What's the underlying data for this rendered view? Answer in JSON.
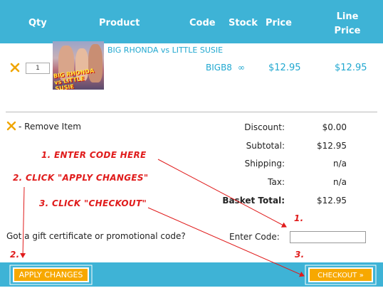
{
  "header": {
    "qty": "Qty",
    "product": "Product",
    "code": "Code",
    "stock": "Stock",
    "price": "Price",
    "line_price": "Line Price"
  },
  "item": {
    "quantity": "1",
    "product_name": "BIG RHONDA vs LITTLE SUSIE",
    "thumbnail_text": "BIG RHONDA vs LITTLE SUSIE",
    "code": "BIGB8",
    "stock": "∞",
    "price": "$12.95",
    "line_price": "$12.95"
  },
  "remove_label": "- Remove Item",
  "summary": {
    "discount_label": "Discount:",
    "discount_value": "$0.00",
    "subtotal_label": "Subtotal:",
    "subtotal_value": "$12.95",
    "shipping_label": "Shipping:",
    "shipping_value": "n/a",
    "tax_label": "Tax:",
    "tax_value": "n/a",
    "total_label": "Basket Total:",
    "total_value": "$12.95"
  },
  "promo": {
    "question": "Got a gift certificate or promotional code?",
    "enter_label": "Enter Code:",
    "input_value": ""
  },
  "buttons": {
    "apply": "APPLY CHANGES",
    "checkout": "CHECKOUT",
    "checkout_arrow": "»"
  },
  "annotations": {
    "step1": "1. ENTER CODE HERE",
    "step2": "2. CLICK \"APPLY CHANGES\"",
    "step3": "3. CLICK \"CHECKOUT\"",
    "marker1": "1.",
    "marker2": "2.",
    "marker3": "3."
  },
  "colors": {
    "header_bg": "#3eb3d6",
    "link": "#21a8d0",
    "button": "#f7a800",
    "annotation": "#e01b1b",
    "remove_icon": "#f0a500"
  },
  "icons": {
    "remove": "x-icon",
    "stock": "infinity-icon"
  }
}
